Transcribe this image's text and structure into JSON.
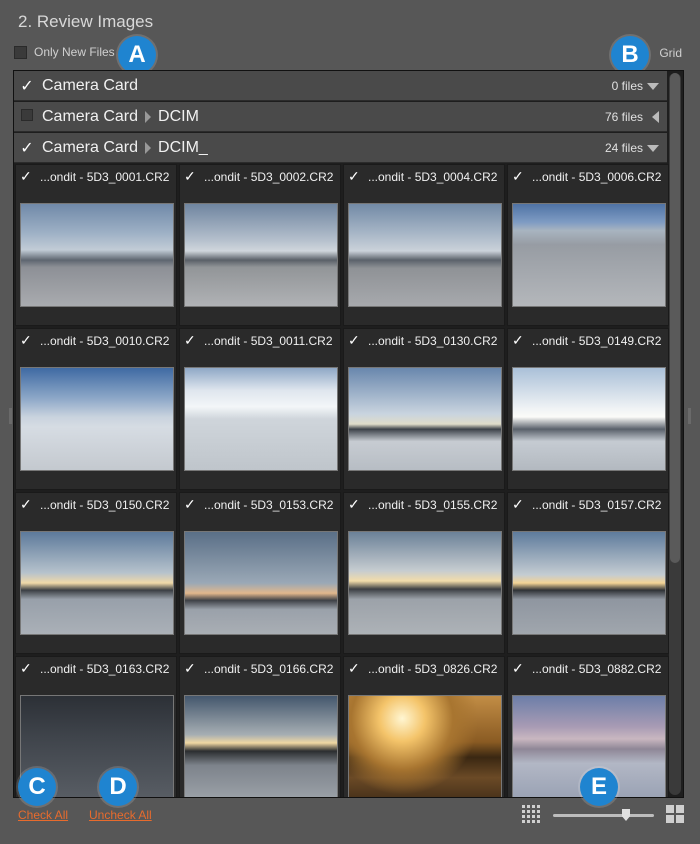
{
  "panel": {
    "title": "2. Review Images"
  },
  "only_new": {
    "label": "Only New Files",
    "checked": false
  },
  "view_mode": {
    "label": "Grid"
  },
  "callouts": {
    "a": "A",
    "b": "B",
    "c": "C",
    "d": "D",
    "e": "E"
  },
  "folders": [
    {
      "checked": true,
      "name": "Camera Card",
      "sub": "",
      "count": "0 files",
      "expanded": true
    },
    {
      "checked": false,
      "name": "Camera Card",
      "sub": "DCIM",
      "count": "76 files",
      "expanded": false
    },
    {
      "checked": true,
      "name": "Camera Card",
      "sub": "DCIM_",
      "count": "24 files",
      "expanded": true
    }
  ],
  "thumbnails": [
    {
      "name": "...ondit - 5D3_0001.CR2",
      "checked": true
    },
    {
      "name": "...ondit - 5D3_0002.CR2",
      "checked": true
    },
    {
      "name": "...ondit - 5D3_0004.CR2",
      "checked": true
    },
    {
      "name": "...ondit - 5D3_0006.CR2",
      "checked": true
    },
    {
      "name": "...ondit - 5D3_0010.CR2",
      "checked": true
    },
    {
      "name": "...ondit - 5D3_0011.CR2",
      "checked": true
    },
    {
      "name": "...ondit - 5D3_0130.CR2",
      "checked": true
    },
    {
      "name": "...ondit - 5D3_0149.CR2",
      "checked": true
    },
    {
      "name": "...ondit - 5D3_0150.CR2",
      "checked": true
    },
    {
      "name": "...ondit - 5D3_0153.CR2",
      "checked": true
    },
    {
      "name": "...ondit - 5D3_0155.CR2",
      "checked": true
    },
    {
      "name": "...ondit - 5D3_0157.CR2",
      "checked": true
    },
    {
      "name": "...ondit - 5D3_0163.CR2",
      "checked": true
    },
    {
      "name": "...ondit - 5D3_0166.CR2",
      "checked": true
    },
    {
      "name": "...ondit - 5D3_0826.CR2",
      "checked": true
    },
    {
      "name": "...ondit - 5D3_0882.CR2",
      "checked": true
    }
  ],
  "footer": {
    "check_all": "Check All",
    "uncheck_all": "Uncheck All"
  },
  "thumbnail_size": {
    "level": 0.72
  },
  "colors": {
    "accent_callout": "#1f84d0",
    "link": "#e86b2d",
    "panel_bg": "#575757",
    "browser_bg": "#1e1e1e"
  }
}
